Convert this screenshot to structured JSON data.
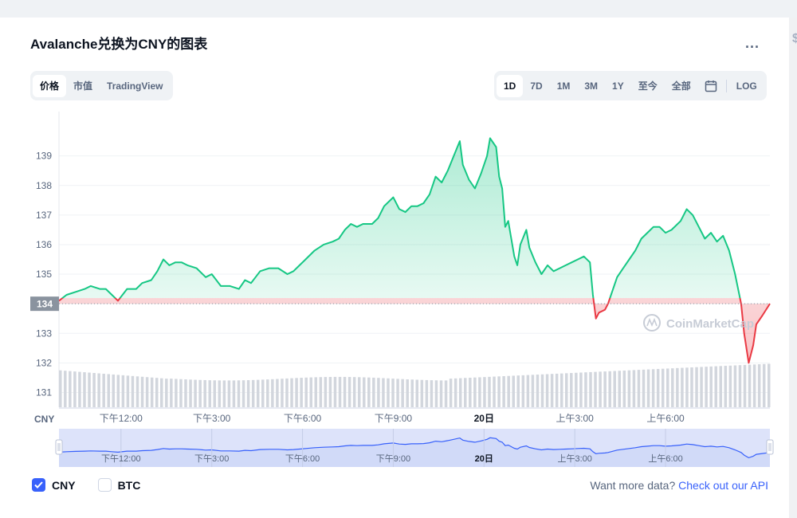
{
  "page": {
    "title": "Avalanche兑换为CNY的图表",
    "more_label": "...",
    "edge_glyph": "$"
  },
  "view_tabs": [
    {
      "label": "价格",
      "active": true
    },
    {
      "label": "市值",
      "active": false
    },
    {
      "label": "TradingView",
      "active": false
    }
  ],
  "range_tabs": [
    {
      "label": "1D",
      "active": true
    },
    {
      "label": "7D",
      "active": false
    },
    {
      "label": "1M",
      "active": false
    },
    {
      "label": "3M",
      "active": false
    },
    {
      "label": "1Y",
      "active": false
    },
    {
      "label": "至今",
      "active": false
    },
    {
      "label": "全部",
      "active": false
    }
  ],
  "log_label": "LOG",
  "icons": {
    "calendar": "calendar-icon",
    "more": "more-dots-icon",
    "check": "check-icon",
    "watermark": "coinmarketcap-logo-icon"
  },
  "colors": {
    "up": "#16c784",
    "down": "#ea3943",
    "accent": "#3861fb",
    "volume": "#d2d6dd",
    "nav_line": "#3861fb",
    "nav_fill": "#dde3fa"
  },
  "watermark": "CoinMarketCap",
  "chart_data": {
    "type": "line",
    "currency_label": "CNY",
    "ylim": [
      130.5,
      140.5
    ],
    "y_ticks": [
      131,
      132,
      133,
      134,
      135,
      136,
      137,
      138,
      139
    ],
    "reference_price": 134,
    "reference_label": "134",
    "x_ticks": [
      {
        "x": 12,
        "label": "下午12:00"
      },
      {
        "x": 15,
        "label": "下午3:00"
      },
      {
        "x": 18,
        "label": "下午6:00"
      },
      {
        "x": 21,
        "label": "下午9:00"
      },
      {
        "x": 24,
        "label": "20日"
      },
      {
        "x": 27,
        "label": "上午3:00"
      },
      {
        "x": 30,
        "label": "上午6:00"
      }
    ],
    "xlim": [
      9.95,
      33.45
    ],
    "series": [
      {
        "values": [
          [
            9.95,
            134.1
          ],
          [
            10.2,
            134.3
          ],
          [
            10.5,
            134.4
          ],
          [
            10.8,
            134.5
          ],
          [
            11.0,
            134.6
          ],
          [
            11.3,
            134.5
          ],
          [
            11.5,
            134.5
          ],
          [
            11.7,
            134.3
          ],
          [
            11.9,
            134.1
          ],
          [
            12.2,
            134.5
          ],
          [
            12.5,
            134.5
          ],
          [
            12.7,
            134.7
          ],
          [
            13.0,
            134.8
          ],
          [
            13.2,
            135.1
          ],
          [
            13.4,
            135.5
          ],
          [
            13.6,
            135.3
          ],
          [
            13.8,
            135.4
          ],
          [
            14.0,
            135.4
          ],
          [
            14.2,
            135.3
          ],
          [
            14.5,
            135.2
          ],
          [
            14.8,
            134.9
          ],
          [
            15.0,
            135.0
          ],
          [
            15.3,
            134.6
          ],
          [
            15.6,
            134.6
          ],
          [
            15.9,
            134.5
          ],
          [
            16.1,
            134.8
          ],
          [
            16.3,
            134.7
          ],
          [
            16.6,
            135.1
          ],
          [
            16.9,
            135.2
          ],
          [
            17.2,
            135.2
          ],
          [
            17.5,
            135.0
          ],
          [
            17.7,
            135.1
          ],
          [
            17.9,
            135.3
          ],
          [
            18.1,
            135.5
          ],
          [
            18.4,
            135.8
          ],
          [
            18.7,
            136.0
          ],
          [
            19.0,
            136.1
          ],
          [
            19.2,
            136.2
          ],
          [
            19.4,
            136.5
          ],
          [
            19.6,
            136.7
          ],
          [
            19.8,
            136.6
          ],
          [
            20.0,
            136.7
          ],
          [
            20.3,
            136.7
          ],
          [
            20.5,
            136.9
          ],
          [
            20.7,
            137.3
          ],
          [
            21.0,
            137.6
          ],
          [
            21.2,
            137.2
          ],
          [
            21.4,
            137.1
          ],
          [
            21.6,
            137.3
          ],
          [
            21.8,
            137.3
          ],
          [
            22.0,
            137.4
          ],
          [
            22.2,
            137.7
          ],
          [
            22.4,
            138.3
          ],
          [
            22.6,
            138.1
          ],
          [
            22.8,
            138.5
          ],
          [
            23.0,
            139.0
          ],
          [
            23.2,
            139.5
          ],
          [
            23.3,
            138.7
          ],
          [
            23.5,
            138.2
          ],
          [
            23.7,
            137.9
          ],
          [
            23.9,
            138.4
          ],
          [
            24.1,
            139.0
          ],
          [
            24.2,
            139.6
          ],
          [
            24.4,
            139.3
          ],
          [
            24.5,
            138.3
          ],
          [
            24.6,
            137.9
          ],
          [
            24.7,
            136.6
          ],
          [
            24.8,
            136.8
          ],
          [
            24.9,
            136.2
          ],
          [
            25.0,
            135.6
          ],
          [
            25.1,
            135.3
          ],
          [
            25.2,
            136.0
          ],
          [
            25.4,
            136.5
          ],
          [
            25.5,
            135.9
          ],
          [
            25.7,
            135.4
          ],
          [
            25.9,
            135.0
          ],
          [
            26.1,
            135.3
          ],
          [
            26.3,
            135.1
          ],
          [
            26.5,
            135.2
          ],
          [
            26.7,
            135.3
          ],
          [
            26.9,
            135.4
          ],
          [
            27.1,
            135.5
          ],
          [
            27.3,
            135.6
          ],
          [
            27.5,
            135.4
          ],
          [
            27.6,
            134.3
          ],
          [
            27.7,
            133.5
          ],
          [
            27.8,
            133.7
          ],
          [
            28.0,
            133.8
          ],
          [
            28.1,
            134.0
          ],
          [
            28.2,
            134.3
          ],
          [
            28.4,
            134.9
          ],
          [
            28.6,
            135.2
          ],
          [
            28.8,
            135.5
          ],
          [
            29.0,
            135.8
          ],
          [
            29.2,
            136.2
          ],
          [
            29.4,
            136.4
          ],
          [
            29.6,
            136.6
          ],
          [
            29.8,
            136.6
          ],
          [
            30.0,
            136.4
          ],
          [
            30.2,
            136.5
          ],
          [
            30.5,
            136.8
          ],
          [
            30.7,
            137.2
          ],
          [
            30.9,
            137.0
          ],
          [
            31.1,
            136.6
          ],
          [
            31.3,
            136.2
          ],
          [
            31.5,
            136.4
          ],
          [
            31.7,
            136.1
          ],
          [
            31.9,
            136.3
          ],
          [
            32.1,
            135.8
          ],
          [
            32.3,
            135.0
          ],
          [
            32.5,
            134.0
          ],
          [
            32.6,
            133.0
          ],
          [
            32.75,
            132.0
          ],
          [
            32.9,
            132.6
          ],
          [
            33.0,
            133.3
          ],
          [
            33.2,
            133.6
          ],
          [
            33.45,
            134.0
          ]
        ]
      }
    ],
    "volume": {
      "start": 0.62,
      "dip": 0.48,
      "end": 0.73
    }
  },
  "legend": [
    {
      "label": "CNY",
      "checked": true
    },
    {
      "label": "BTC",
      "checked": false
    }
  ],
  "footer": {
    "prefix": "Want more data?",
    "link": "Check out our API"
  }
}
